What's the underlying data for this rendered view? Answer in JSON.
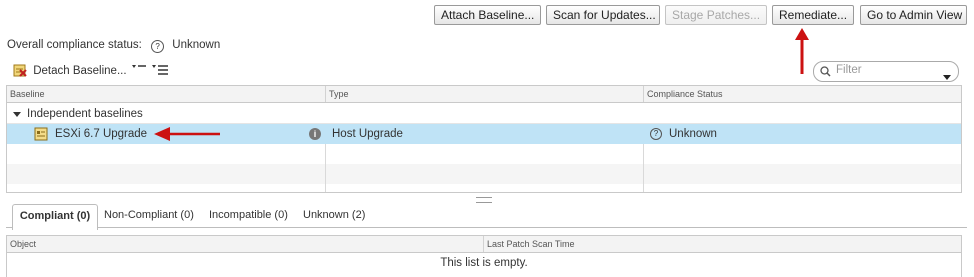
{
  "toolbar": {
    "attach_baseline": "Attach Baseline...",
    "scan_for_updates": "Scan for Updates...",
    "stage_patches": "Stage Patches...",
    "remediate": "Remediate...",
    "admin_view": "Go to Admin View"
  },
  "compliance": {
    "label": "Overall compliance status:",
    "value": "Unknown"
  },
  "actions": {
    "detach_baseline": "Detach Baseline...",
    "filter_placeholder": "Filter"
  },
  "baselines_table": {
    "columns": [
      "Baseline",
      "Type",
      "Compliance Status"
    ],
    "group": "Independent baselines",
    "rows": [
      {
        "name": "ESXi 6.7 Upgrade",
        "type": "Host Upgrade",
        "status": "Unknown"
      }
    ]
  },
  "tabs": [
    {
      "label": "Compliant (0)"
    },
    {
      "label": "Non-Compliant (0)"
    },
    {
      "label": "Incompatible (0)"
    },
    {
      "label": "Unknown (2)"
    }
  ],
  "objects_table": {
    "columns": [
      "Object",
      "Last Patch Scan Time"
    ],
    "empty_message": "This list is empty."
  },
  "colors": {
    "selection": "#bfe3f6",
    "annotation_arrow": "#cc1111"
  }
}
